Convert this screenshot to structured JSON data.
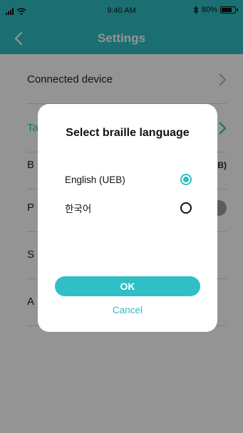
{
  "status_bar": {
    "time": "9:40 AM",
    "battery_text": "80%",
    "battery_level": 0.8,
    "icons": [
      "signal-icon",
      "wifi-icon",
      "bluetooth-icon",
      "battery-icon"
    ]
  },
  "header": {
    "title": "Settings",
    "back_icon": "chevron-left-icon"
  },
  "settings": {
    "rows": [
      {
        "label": "Connected device",
        "trailing": "chevron-right-icon"
      },
      {
        "label": "Ta",
        "trailing": "chevron-right-icon"
      },
      {
        "label": "B",
        "value": "B)"
      },
      {
        "label": "P",
        "trailing": "toggle"
      },
      {
        "label": "S"
      },
      {
        "label": "A"
      }
    ]
  },
  "dialog": {
    "title": "Select braille language",
    "options": [
      {
        "label": "English (UEB)",
        "selected": true
      },
      {
        "label": "한국어",
        "selected": false
      }
    ],
    "ok_label": "OK",
    "cancel_label": "Cancel"
  },
  "colors": {
    "accent": "#2fbfc4",
    "overlay": "rgba(0,0,0,0.42)"
  }
}
